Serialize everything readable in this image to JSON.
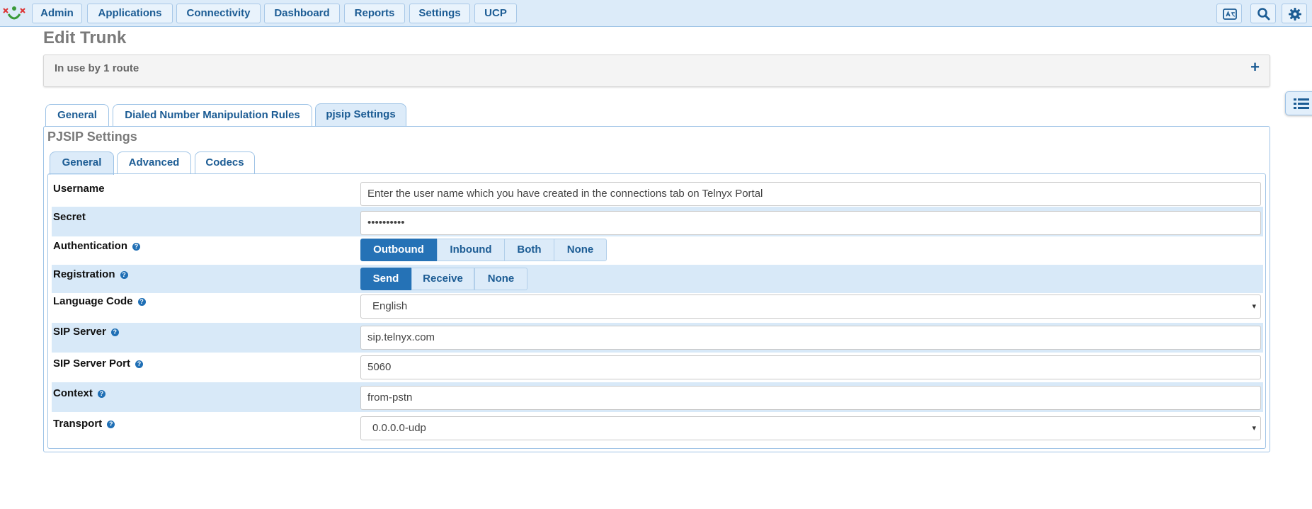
{
  "nav": {
    "items": [
      {
        "label": "Admin"
      },
      {
        "label": "Applications"
      },
      {
        "label": "Connectivity"
      },
      {
        "label": "Dashboard"
      },
      {
        "label": "Reports"
      },
      {
        "label": "Settings"
      },
      {
        "label": "UCP"
      }
    ],
    "icons": [
      "language-icon",
      "search-icon",
      "gear-icon"
    ]
  },
  "page": {
    "title": "Edit Trunk",
    "in_use": "In use by 1 route",
    "expand_symbol": "+"
  },
  "tabs": [
    {
      "label": "General"
    },
    {
      "label": "Dialed Number Manipulation Rules"
    },
    {
      "label": "pjsip Settings",
      "active": true
    }
  ],
  "pjsip": {
    "title": "PJSIP Settings",
    "subtabs": [
      {
        "label": "General",
        "active": true
      },
      {
        "label": "Advanced"
      },
      {
        "label": "Codecs"
      }
    ],
    "fields": {
      "username": {
        "label": "Username",
        "placeholder": "Enter the user name which you have created in the connections tab on Telnyx Portal"
      },
      "secret": {
        "label": "Secret",
        "value": "••••••••••"
      },
      "authentication": {
        "label": "Authentication",
        "options": [
          "Outbound",
          "Inbound",
          "Both",
          "None"
        ],
        "selected": "Outbound"
      },
      "registration": {
        "label": "Registration",
        "options": [
          "Send",
          "Receive",
          "None"
        ],
        "selected": "Send"
      },
      "language_code": {
        "label": "Language Code",
        "value": "English"
      },
      "sip_server": {
        "label": "SIP Server",
        "value": "sip.telnyx.com"
      },
      "sip_server_port": {
        "label": "SIP Server Port",
        "value": "5060"
      },
      "context": {
        "label": "Context",
        "value": "from-pstn"
      },
      "transport": {
        "label": "Transport",
        "value": "0.0.0.0-udp"
      }
    }
  },
  "help_symbol": "?",
  "select_arrow": "▾",
  "colors": {
    "accent": "#2572b6",
    "nav_bg": "#dcebf9",
    "row_alt": "#d8e9f8",
    "link": "#1c5c94"
  }
}
